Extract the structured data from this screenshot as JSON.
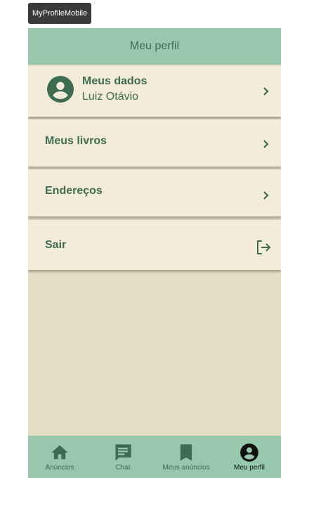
{
  "frame_label": "MyProfileMobile",
  "header": {
    "title": "Meu perfil"
  },
  "profile": {
    "title": "Meus dados",
    "name": "Luiz Otávio"
  },
  "menu": {
    "books": "Meus livros",
    "addresses": "Endereços",
    "logout": "Sair"
  },
  "bottom_nav": [
    {
      "label": "Anúncios",
      "icon": "home-icon",
      "active": false
    },
    {
      "label": "Chat",
      "icon": "chat-icon",
      "active": false
    },
    {
      "label": "Meus anúncios",
      "icon": "bookmark-icon",
      "active": false
    },
    {
      "label": "Meu perfil",
      "icon": "account-circle-icon",
      "active": true
    }
  ],
  "colors": {
    "header_bg": "#97c7ad",
    "item_bg": "#f3ecd8",
    "page_bg": "#e3dec4",
    "text": "#3f6b50",
    "active": "#111111"
  }
}
